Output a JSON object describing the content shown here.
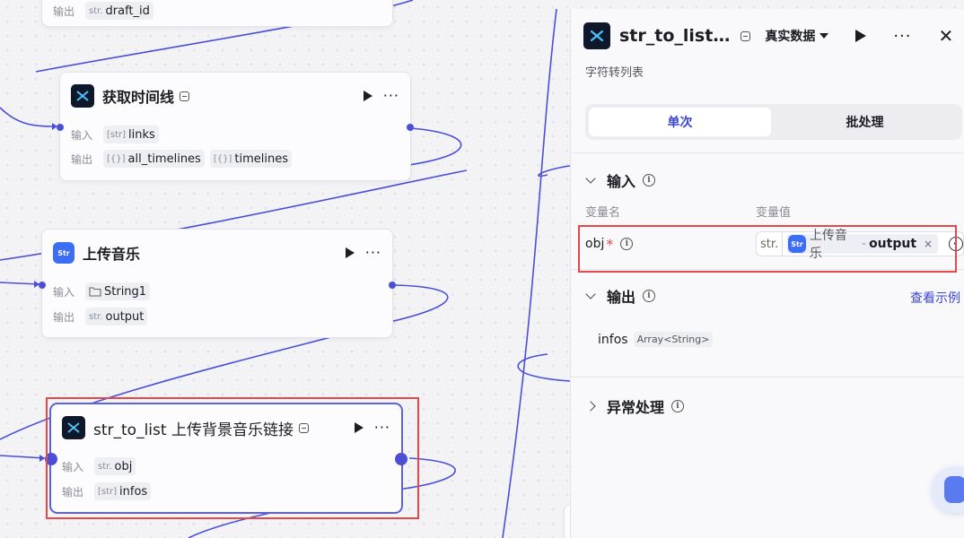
{
  "nodes": {
    "top_partial": {
      "label_out": "输出",
      "out_prefix": "str.",
      "out_value": "draft_id"
    },
    "get_timeline": {
      "title": "获取时间线",
      "label_in": "输入",
      "in_prefix": "[str]",
      "in_value": "links",
      "label_out": "输出",
      "outputs": [
        {
          "prefix": "[{}]",
          "value": "all_timelines"
        },
        {
          "prefix": "[{}]",
          "value": "timelines"
        }
      ]
    },
    "upload_music": {
      "title": "上传音乐",
      "icon_text": "Str",
      "label_in": "输入",
      "in_value": "String1",
      "label_out": "输出",
      "out_prefix": "str.",
      "out_value": "output"
    },
    "str_to_list": {
      "title": "str_to_list 上传背景音乐链接",
      "label_in": "输入",
      "in_prefix": "str.",
      "in_value": "obj",
      "label_out": "输出",
      "out_prefix": "[str]",
      "out_value": "infos"
    }
  },
  "panel": {
    "title": "str_to_list…",
    "real_data": "真实数据",
    "description": "字符转列表",
    "tabs": [
      "单次",
      "批处理"
    ],
    "input_section": "输入",
    "col_name": "变量名",
    "col_value": "变量值",
    "var_name": "obj",
    "required_mark": "*",
    "value_prefix": "str.",
    "value_source": "上传音乐",
    "value_dot": "-",
    "value_output": "output",
    "output_section": "输出",
    "view_example": "查看示例",
    "output_name": "infos",
    "output_type": "Array<String>",
    "error_section": "异常处理",
    "close_glyph": "✕",
    "more_glyph": "···",
    "info_glyph": "i",
    "chip_close": "×"
  },
  "colors": {
    "accent": "#3a45d1",
    "edge": "#4a4fd6",
    "highlight": "#e54848"
  }
}
